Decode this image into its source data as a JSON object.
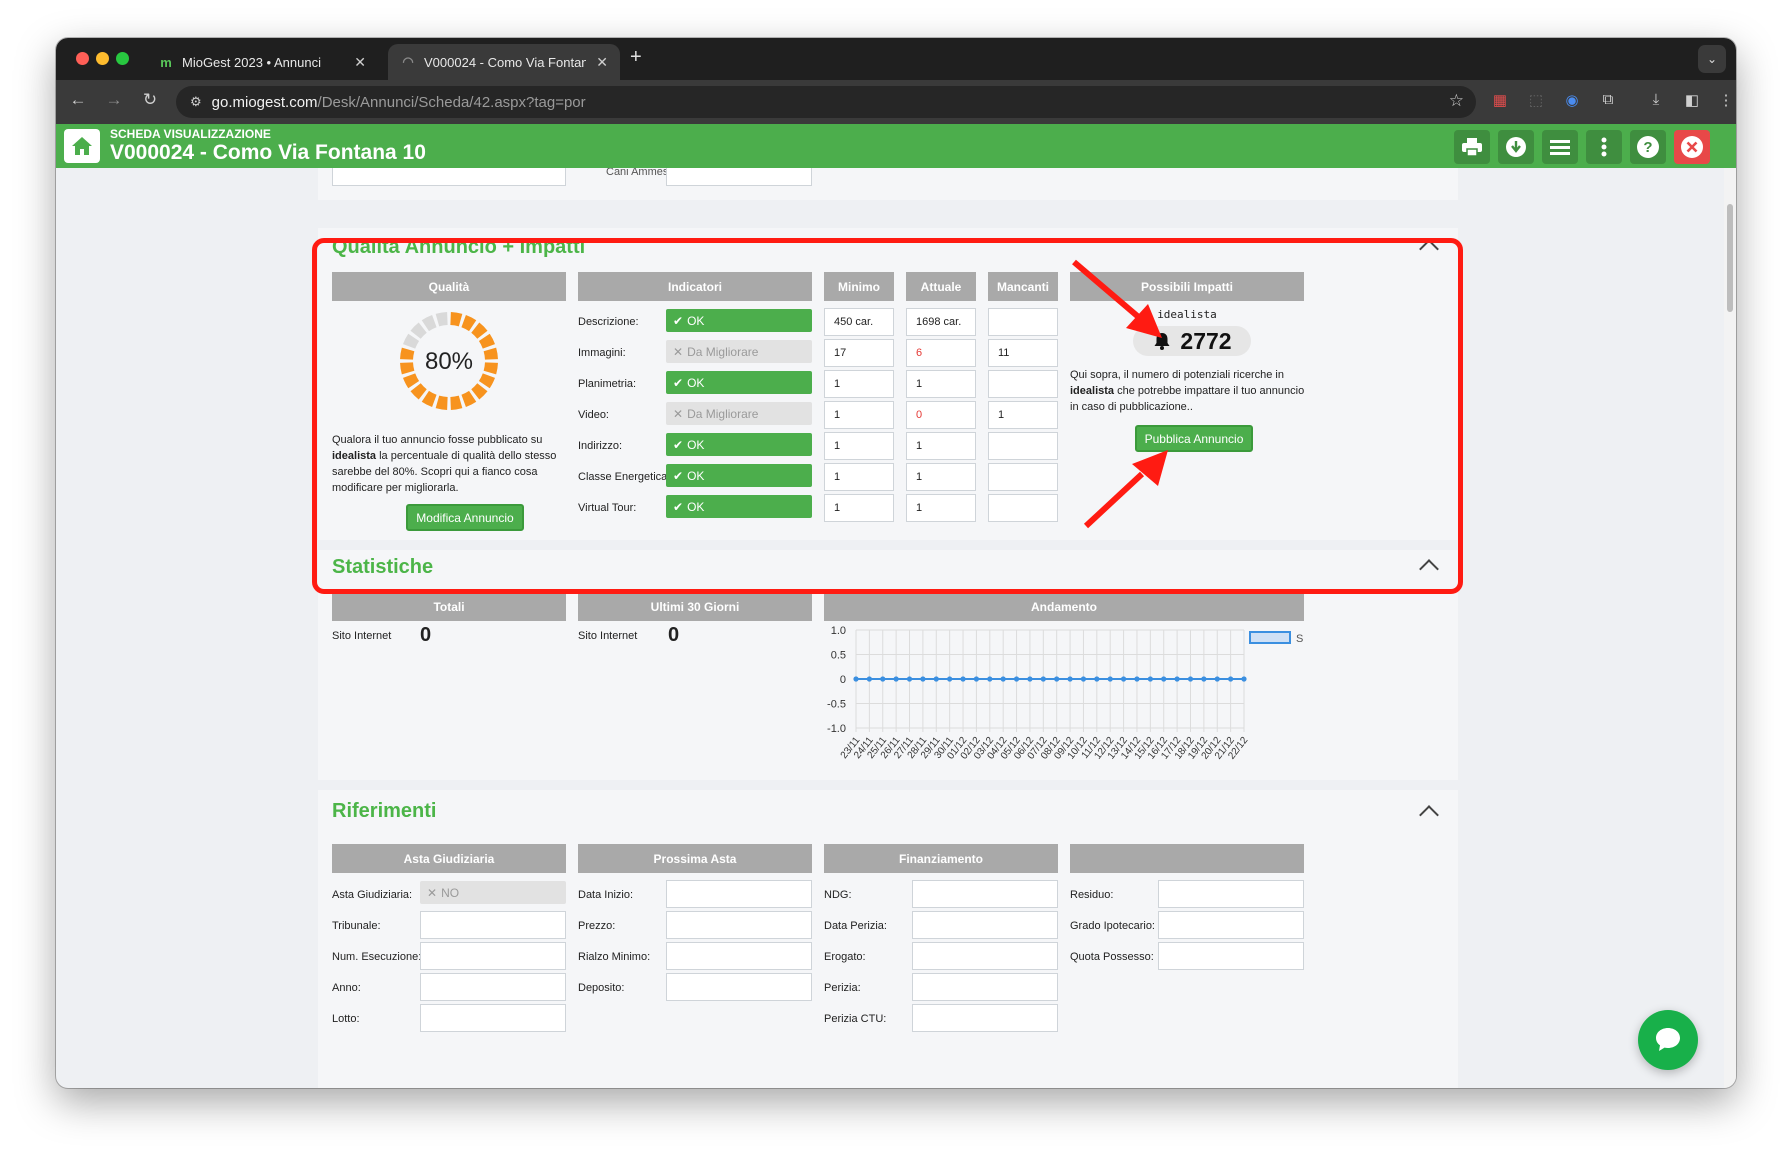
{
  "browser": {
    "tabs": [
      {
        "title": "MioGest 2023 • Annunci",
        "active": false
      },
      {
        "title": "V000024 - Como Via Fontana 10",
        "active": true
      }
    ],
    "url_host": "go.miogest.com",
    "url_path": "/Desk/Annunci/Scheda/42.aspx?tag=por"
  },
  "app": {
    "subtitle": "SCHEDA VISUALIZZAZIONE",
    "title": "V000024 - Como Via Fontana 10",
    "partial_label": "Cani Ammessi:"
  },
  "quality": {
    "title": "Qualità Annuncio + Impatti",
    "headers": {
      "quality": "Qualità",
      "indicators": "Indicatori",
      "min": "Minimo",
      "current": "Attuale",
      "missing": "Mancanti",
      "impacts": "Possibili Impatti"
    },
    "percent_label": "80%",
    "percent": 80,
    "description_parts": [
      "Qualora il tuo annuncio fosse pubblicato su ",
      "idealista",
      " la percentuale di qualità dello stesso sarebbe del 80%. Scopri qui a fianco cosa modificare per migliorarla."
    ],
    "edit_button": "Modifica Annuncio",
    "indicators": [
      {
        "label": "Descrizione:",
        "status": "OK",
        "ok": true,
        "min": "450 car.",
        "current": "1698 car.",
        "missing": "",
        "current_red": false
      },
      {
        "label": "Immagini:",
        "status": "Da Migliorare",
        "ok": false,
        "min": "17",
        "current": "6",
        "missing": "11",
        "current_red": true
      },
      {
        "label": "Planimetria:",
        "status": "OK",
        "ok": true,
        "min": "1",
        "current": "1",
        "missing": "",
        "current_red": false
      },
      {
        "label": "Video:",
        "status": "Da Migliorare",
        "ok": false,
        "min": "1",
        "current": "0",
        "missing": "1",
        "current_red": true
      },
      {
        "label": "Indirizzo:",
        "status": "OK",
        "ok": true,
        "min": "1",
        "current": "1",
        "missing": "",
        "current_red": false
      },
      {
        "label": "Classe Energetica:",
        "status": "OK",
        "ok": true,
        "min": "1",
        "current": "1",
        "missing": "",
        "current_red": false
      },
      {
        "label": "Virtual Tour:",
        "status": "OK",
        "ok": true,
        "min": "1",
        "current": "1",
        "missing": "",
        "current_red": false
      }
    ],
    "portal_name": "idealista",
    "impact_count": "2772",
    "impact_text_parts": [
      "Qui sopra, il numero di potenziali ricerche in ",
      "idealista",
      " che potrebbe impattare il tuo annuncio in caso di pubblicazione.."
    ],
    "publish_button": "Pubblica Annuncio"
  },
  "stats": {
    "title": "Statistiche",
    "headers": {
      "totals": "Totali",
      "last30": "Ultimi 30 Giorni",
      "trend": "Andamento"
    },
    "site_label": "Sito Internet",
    "total_value": "0",
    "last30_value": "0"
  },
  "chart_data": {
    "type": "line",
    "y_ticks": [
      "1.0",
      "0.5",
      "0",
      "-0.5",
      "-1.0"
    ],
    "ylim": [
      -1,
      1
    ],
    "x": [
      "23/11",
      "24/11",
      "25/11",
      "26/11",
      "27/11",
      "28/11",
      "29/11",
      "30/11",
      "01/12",
      "02/12",
      "03/12",
      "04/12",
      "05/12",
      "06/12",
      "07/12",
      "08/12",
      "09/12",
      "10/12",
      "11/12",
      "12/12",
      "13/12",
      "14/12",
      "15/12",
      "16/12",
      "17/12",
      "18/12",
      "19/12",
      "20/12",
      "21/12",
      "22/12"
    ],
    "series": [
      {
        "name": "Sito Internet",
        "values": [
          0,
          0,
          0,
          0,
          0,
          0,
          0,
          0,
          0,
          0,
          0,
          0,
          0,
          0,
          0,
          0,
          0,
          0,
          0,
          0,
          0,
          0,
          0,
          0,
          0,
          0,
          0,
          0,
          0,
          0
        ],
        "color": "#3b8fe0"
      }
    ],
    "grid": true,
    "legend": "top-right"
  },
  "refs": {
    "title": "Riferimenti",
    "headers": {
      "auction": "Asta Giudiziaria",
      "next": "Prossima Asta",
      "finance": "Finanziamento",
      "other": ""
    },
    "auction_fields": [
      {
        "label": "Asta Giudiziaria:",
        "value": "NO",
        "type": "no"
      },
      {
        "label": "Tribunale:",
        "value": ""
      },
      {
        "label": "Num. Esecuzione:",
        "value": ""
      },
      {
        "label": "Anno:",
        "value": ""
      },
      {
        "label": "Lotto:",
        "value": ""
      }
    ],
    "next_fields": [
      {
        "label": "Data Inizio:",
        "value": ""
      },
      {
        "label": "Prezzo:",
        "value": ""
      },
      {
        "label": "Rialzo Minimo:",
        "value": ""
      },
      {
        "label": "Deposito:",
        "value": ""
      }
    ],
    "finance_fields": [
      {
        "label": "NDG:",
        "value": ""
      },
      {
        "label": "Data Perizia:",
        "value": ""
      },
      {
        "label": "Erogato:",
        "value": ""
      },
      {
        "label": "Perizia:",
        "value": ""
      },
      {
        "label": "Perizia CTU:",
        "value": ""
      }
    ],
    "other_fields": [
      {
        "label": "Residuo:",
        "value": ""
      },
      {
        "label": "Grado Ipotecario:",
        "value": ""
      },
      {
        "label": "Quota Possesso:",
        "value": ""
      }
    ]
  },
  "colors": {
    "brand_green": "#4cae4c",
    "title_green": "#4cb548",
    "highlight_red": "#ff1b12",
    "close_red": "#e84848"
  }
}
